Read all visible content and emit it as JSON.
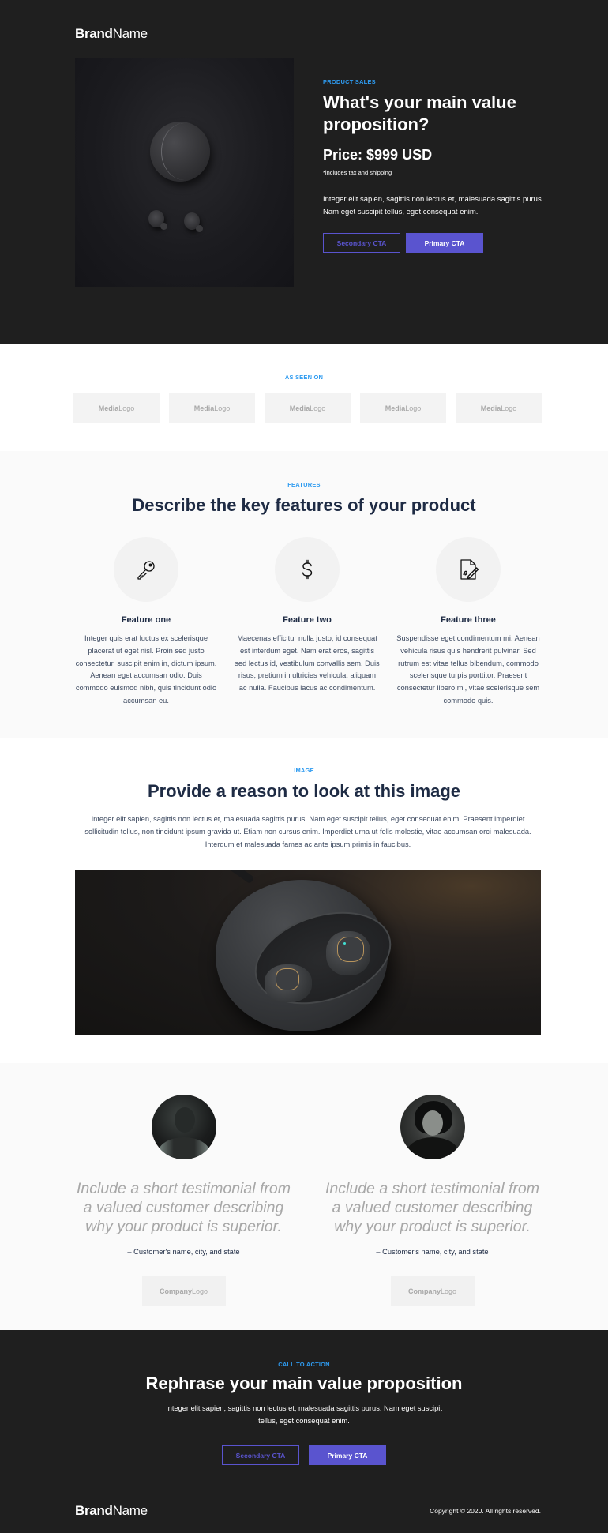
{
  "colors": {
    "dark_bg": "#1f1f1f",
    "accent_blue": "#2e9bf0",
    "primary_purple": "#5a54cf",
    "heading_navy": "#1e2b44",
    "light_bg": "#fafafa",
    "logo_box": "#f3f3f3"
  },
  "brand": {
    "bold": "Brand",
    "regular": "Name"
  },
  "hero": {
    "eyebrow": "PRODUCT SALES",
    "title": "What's your main value proposition?",
    "price": "Price: $999 USD",
    "note": "*includes tax and shipping",
    "body": "Integer elit sapien, sagittis non lectus et, malesuada sagittis purus. Nam eget suscipit tellus, eget consequat enim.",
    "secondary_cta": "Secondary CTA",
    "primary_cta": "Primary CTA",
    "image_alt": "Earbuds and charging case on dark surface"
  },
  "media": {
    "eyebrow": "AS SEEN ON",
    "logos": [
      {
        "bold": "Media",
        "regular": "Logo"
      },
      {
        "bold": "Media",
        "regular": "Logo"
      },
      {
        "bold": "Media",
        "regular": "Logo"
      },
      {
        "bold": "Media",
        "regular": "Logo"
      },
      {
        "bold": "Media",
        "regular": "Logo"
      }
    ]
  },
  "features": {
    "eyebrow": "FEATURES",
    "title": "Describe the key features of your product",
    "items": [
      {
        "icon": "key-icon",
        "title": "Feature one",
        "body": "Integer quis erat luctus ex scelerisque placerat ut eget nisl. Proin sed justo consectetur, suscipit enim in, dictum ipsum. Aenean eget accumsan odio. Duis commodo euismod nibh, quis tincidunt odio accumsan eu."
      },
      {
        "icon": "dollar-icon",
        "title": "Feature two",
        "body": "Maecenas efficitur nulla justo, id consequat est interdum eget. Nam erat eros, sagittis sed lectus id, vestibulum convallis sem. Duis risus, pretium in ultricies vehicula, aliquam ac nulla. Faucibus lacus ac condimentum."
      },
      {
        "icon": "document-sign-icon",
        "title": "Feature three",
        "body": "Suspendisse eget condimentum mi. Aenean vehicula risus quis hendrerit pulvinar. Sed rutrum est vitae tellus bibendum, commodo scelerisque turpis porttitor. Praesent consectetur libero mi, vitae scelerisque sem commodo quis."
      }
    ]
  },
  "image_section": {
    "eyebrow": "IMAGE",
    "title": "Provide a reason to look at this image",
    "body": "Integer elit sapien, sagittis non lectus et, malesuada sagittis purus. Nam eget suscipit tellus, eget consequat enim. Praesent imperdiet sollicitudin tellus, non tincidunt ipsum gravida ut. Etiam non cursus enim. Imperdiet urna ut felis molestie, vitae accumsan orci malesuada. Interdum et malesuada fames ac ante ipsum primis in faucibus."
  },
  "testimonials": [
    {
      "quote": "Include a short testimonial from a valued customer describing why your product is superior.",
      "cite": "– Customer's name, city, and state",
      "logo": {
        "bold": "Company",
        "regular": "Logo"
      }
    },
    {
      "quote": "Include a short testimonial from a valued customer describing why your product is superior.",
      "cite": "– Customer's name, city, and state",
      "logo": {
        "bold": "Company",
        "regular": "Logo"
      }
    }
  ],
  "cta": {
    "eyebrow": "CALL TO ACTION",
    "title": "Rephrase your main value proposition",
    "body": "Integer elit sapien, sagittis non lectus et, malesuada sagittis purus. Nam eget suscipit tellus, eget consequat enim.",
    "secondary_cta": "Secondary CTA",
    "primary_cta": "Primary CTA"
  },
  "footer": {
    "copyright": "Copyright © 2020. All rights reserved."
  }
}
